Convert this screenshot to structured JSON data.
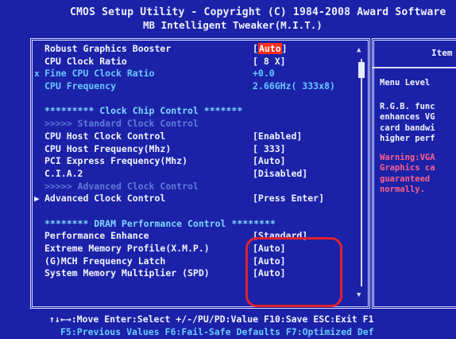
{
  "header": {
    "title_line1": "CMOS Setup Utility - Copyright (C) 1984-2008 Award Software",
    "title_line2": "MB Intelligent Tweaker(M.I.T.)"
  },
  "settings": [
    {
      "label": "Robust Graphics Booster",
      "value": "[Auto]",
      "style": "white",
      "value_highlight": true
    },
    {
      "label": "CPU Clock Ratio",
      "value": "[ 8 X]",
      "style": "white"
    },
    {
      "label": "Fine CPU Clock Ratio",
      "value": "+0.0",
      "style": "cyan",
      "marker": "x"
    },
    {
      "label": "CPU Frequency",
      "value": "2.66GHz( 333x8)",
      "style": "cyan"
    },
    {
      "label": "",
      "value": "",
      "style": "white"
    },
    {
      "label": "********* Clock Chip Control *******",
      "value": "",
      "style": "section"
    },
    {
      "label": ">>>>> Standard Clock Control",
      "value": "",
      "style": "dim"
    },
    {
      "label": "CPU Host Clock Control",
      "value": "[Enabled]",
      "style": "white"
    },
    {
      "label": "CPU Host Frequency(Mhz)",
      "value": "[ 333]",
      "style": "white"
    },
    {
      "label": "PCI Express Frequency(Mhz)",
      "value": "[Auto]",
      "style": "white"
    },
    {
      "label": "C.I.A.2",
      "value": "[Disabled]",
      "style": "white"
    },
    {
      "label": ">>>>> Advanced Clock Control",
      "value": "",
      "style": "dim"
    },
    {
      "label": "Advanced Clock Control",
      "value": "[Press Enter]",
      "style": "white",
      "marker": "▶"
    },
    {
      "label": "",
      "value": "",
      "style": "white"
    },
    {
      "label": "******** DRAM Performance Control ********",
      "value": "",
      "style": "section"
    },
    {
      "label": "Performance Enhance",
      "value": "[Standard]",
      "style": "white"
    },
    {
      "label": "Extreme Memory Profile(X.M.P.)",
      "value": "[Auto]",
      "style": "white"
    },
    {
      "label": "(G)MCH Frequency Latch",
      "value": "[Auto]",
      "style": "white"
    },
    {
      "label": "System Memory Multiplier (SPD)",
      "value": "[Auto]",
      "style": "white"
    }
  ],
  "help": {
    "title": "Item",
    "menu_level": "Menu Level",
    "description_lines": [
      "R.G.B. func",
      "enhances VG",
      "card bandwi",
      "higher perf"
    ],
    "warning_lines": [
      "Warning:VGA",
      "Graphics ca",
      "guaranteed",
      "normally."
    ]
  },
  "footer": {
    "line1": "↑↓←→:Move  Enter:Select  +/-/PU/PD:Value  F10:Save  ESC:Exit  F1",
    "line2": "F5:Previous Values  F6:Fail-Safe Defaults  F7:Optimized Def"
  },
  "colors": {
    "background": "#1b22a8",
    "highlight": "#ff2d1a",
    "annotation": "#e0222e"
  }
}
